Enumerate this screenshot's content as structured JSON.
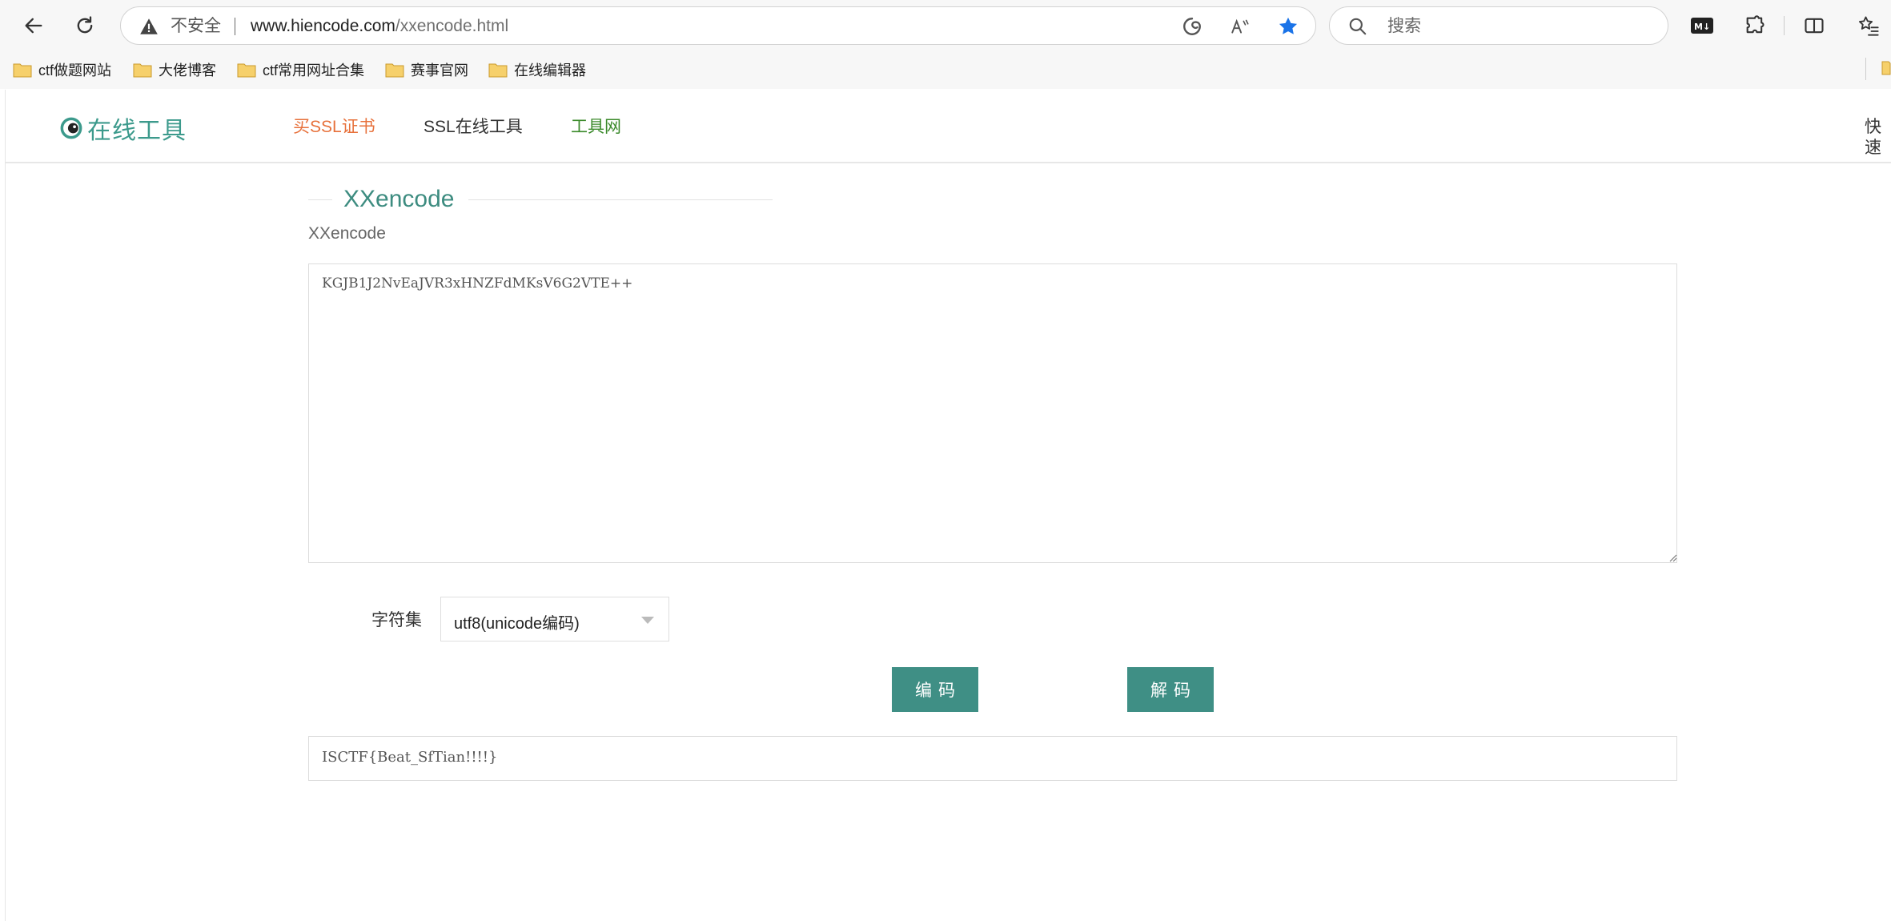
{
  "browser": {
    "security_label": "不安全",
    "url_host": "www.hiencode.com",
    "url_path": "/xxencode.html",
    "search_placeholder": "搜索",
    "bookmarks": [
      "ctf做题网站",
      "大佬博客",
      "ctf常用网址合集",
      "赛事官网",
      "在线编辑器"
    ]
  },
  "site": {
    "logo_text": "在线工具",
    "nav": [
      "买SSL证书",
      "SSL在线工具",
      "工具网",
      "快速"
    ]
  },
  "main": {
    "section_title": "XXencode",
    "sub_label": "XXencode",
    "input_text": "KGJB1J2NvEaJVR3xHNZFdMKsV6G2VTE++",
    "charset_label": "字符集",
    "charset_value": "utf8(unicode编码)",
    "encode_button": "编码",
    "decode_button": "解码",
    "result_text": "ISCTF{Beat_SfTian!!!!}"
  },
  "colors": {
    "accent": "#3f8f85",
    "nav_highlight": "#e7713b",
    "nav_green": "#3b8a2b"
  }
}
